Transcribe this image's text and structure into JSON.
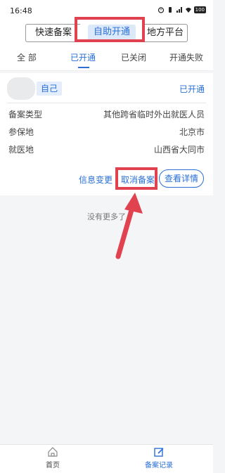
{
  "status_bar": {
    "time": "16:48",
    "battery": "100"
  },
  "segments": [
    {
      "label": "快速备案"
    },
    {
      "label": "自助开通"
    },
    {
      "label": "地方平台"
    }
  ],
  "tabs": [
    {
      "label": "全 部"
    },
    {
      "label": "已开通"
    },
    {
      "label": "已关闭"
    },
    {
      "label": "开通失败"
    }
  ],
  "record": {
    "tag": "自己",
    "status": "已开通",
    "fields": [
      {
        "label": "备案类型",
        "value": "其他跨省临时外出就医人员"
      },
      {
        "label": "参保地",
        "value": "北京市"
      },
      {
        "label": "就医地",
        "value": "山西省大同市"
      }
    ],
    "actions": {
      "change": "信息变更",
      "cancel": "取消备案",
      "detail": "查看详情"
    }
  },
  "list_end_text": "没有更多了",
  "bottom_nav": [
    {
      "label": "首页",
      "icon": "home-icon"
    },
    {
      "label": "备案记录",
      "icon": "record-icon"
    }
  ],
  "colors": {
    "accent": "#2a6fd6",
    "highlight": "#e0424f"
  }
}
